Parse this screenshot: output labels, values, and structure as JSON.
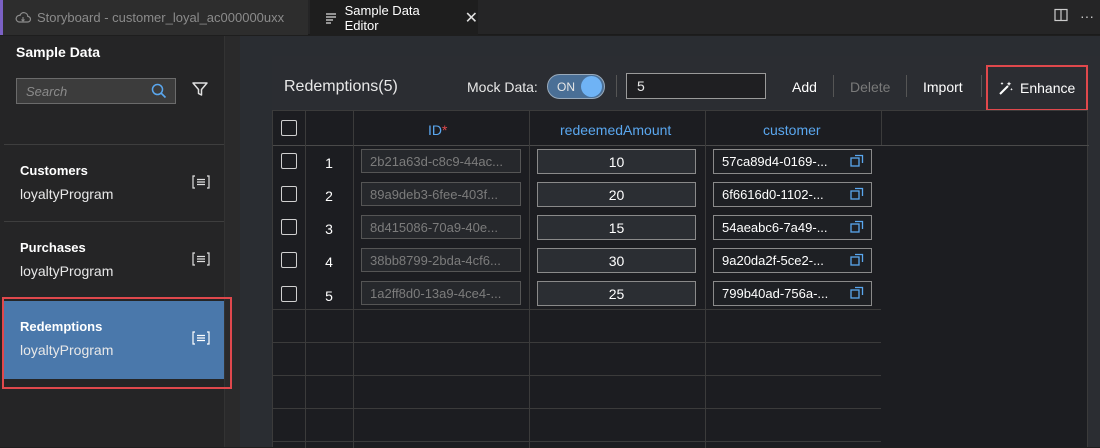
{
  "tabs": [
    {
      "label": "Storyboard - customer_loyal_ac000000uxx",
      "icon": "cloud-icon",
      "active": false
    },
    {
      "label": "Sample Data Editor",
      "icon": "file-lines-icon",
      "active": true
    }
  ],
  "sidebar": {
    "title": "Sample Data",
    "search_placeholder": "Search",
    "entities": [
      {
        "name": "Customers",
        "program": "loyaltyProgram"
      },
      {
        "name": "Purchases",
        "program": "loyaltyProgram"
      },
      {
        "name": "Redemptions",
        "program": "loyaltyProgram",
        "selected": true
      }
    ]
  },
  "toolbar": {
    "title": "Redemptions(5)",
    "mock_label": "Mock Data:",
    "toggle_label": "ON",
    "count_value": "5",
    "add_label": "Add",
    "delete_label": "Delete",
    "import_label": "Import",
    "enhance_label": "Enhance"
  },
  "table": {
    "columns": [
      {
        "label": "ID",
        "required_marker": "*"
      },
      {
        "label": "redeemedAmount"
      },
      {
        "label": "customer"
      }
    ],
    "rows": [
      {
        "num": "1",
        "id": "2b21a63d-c8c9-44ac...",
        "amount": "10",
        "customer": "57ca89d4-0169-..."
      },
      {
        "num": "2",
        "id": "89a9deb3-6fee-403f...",
        "amount": "20",
        "customer": "6f6616d0-1102-..."
      },
      {
        "num": "3",
        "id": "8d415086-70a9-40e...",
        "amount": "15",
        "customer": "54aeabc6-7a49-..."
      },
      {
        "num": "4",
        "id": "38bb8799-2bda-4cf6...",
        "amount": "30",
        "customer": "9a20da2f-5ce2-..."
      },
      {
        "num": "5",
        "id": "1a2ff8d0-13a9-4ce4-...",
        "amount": "25",
        "customer": "799b40ad-756a-..."
      }
    ]
  },
  "colors": {
    "accent": "#5aa7ef",
    "selection": "#4a78ab",
    "highlight_border": "#e0484c",
    "required": "#e0484c"
  }
}
